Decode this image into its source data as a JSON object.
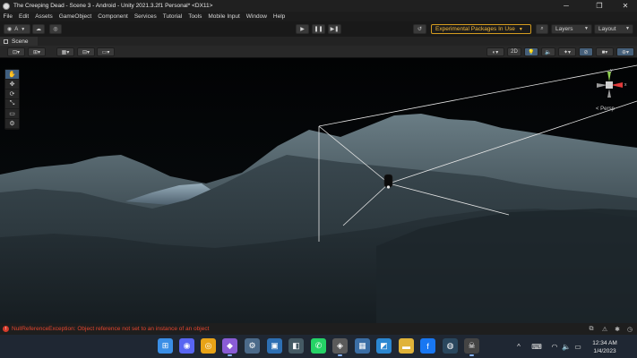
{
  "window": {
    "title": "The Creeping Dead - Scene 3 - Android - Unity 2021.3.2f1 Personal* <DX11>",
    "controls": [
      "─",
      "❐",
      "✕"
    ]
  },
  "menu": [
    "File",
    "Edit",
    "Assets",
    "GameObject",
    "Component",
    "Services",
    "Tutorial",
    "Tools",
    "Mobile Input",
    "Window",
    "Help"
  ],
  "toolbar": {
    "account_label": "A",
    "experimental_packages": "Experimental Packages In Use",
    "layers_label": "Layers",
    "layout_label": "Layout"
  },
  "scene_tab": {
    "label": "Scene"
  },
  "scene_toolbar": {
    "mode_2d": "2D"
  },
  "gizmo": {
    "projection_label": "< Persp",
    "axis_y": "y",
    "axis_x": "x",
    "axis_z": "z"
  },
  "tools": [
    "✋",
    "✥",
    "⟳",
    "⤡",
    "▭",
    "⚙"
  ],
  "status": {
    "error_message": "NullReferenceException: Object reference not set to an instance of an object"
  },
  "taskbar": {
    "time": "12:34 AM",
    "date": "1/4/2023",
    "apps": [
      {
        "name": "start-button",
        "glyph": "⊞",
        "color": "#3a8ee6"
      },
      {
        "name": "discord-app",
        "glyph": "◉",
        "color": "#5865f2"
      },
      {
        "name": "chrome-app",
        "glyph": "◎",
        "color": "#e8a317"
      },
      {
        "name": "visual-studio-app",
        "glyph": "◆",
        "color": "#8a5cd6"
      },
      {
        "name": "settings-app",
        "glyph": "⚙",
        "color": "#4b6a8a"
      },
      {
        "name": "photos-app",
        "glyph": "▣",
        "color": "#2d6fb3"
      },
      {
        "name": "explorer-app",
        "glyph": "◧",
        "color": "#455a64"
      },
      {
        "name": "whatsapp-app",
        "glyph": "✆",
        "color": "#25d366"
      },
      {
        "name": "unity-hub-app",
        "glyph": "◈",
        "color": "#5a5a5a"
      },
      {
        "name": "calculator-app",
        "glyph": "▦",
        "color": "#3b6ea5"
      },
      {
        "name": "store-app",
        "glyph": "◩",
        "color": "#2b87d1"
      },
      {
        "name": "file-explorer-app",
        "glyph": "▬",
        "color": "#e0b339"
      },
      {
        "name": "facebook-app",
        "glyph": "f",
        "color": "#1877f2"
      },
      {
        "name": "steam-app",
        "glyph": "◍",
        "color": "#2a475e"
      },
      {
        "name": "unity-editor-app",
        "glyph": "☠",
        "color": "#444"
      }
    ]
  }
}
